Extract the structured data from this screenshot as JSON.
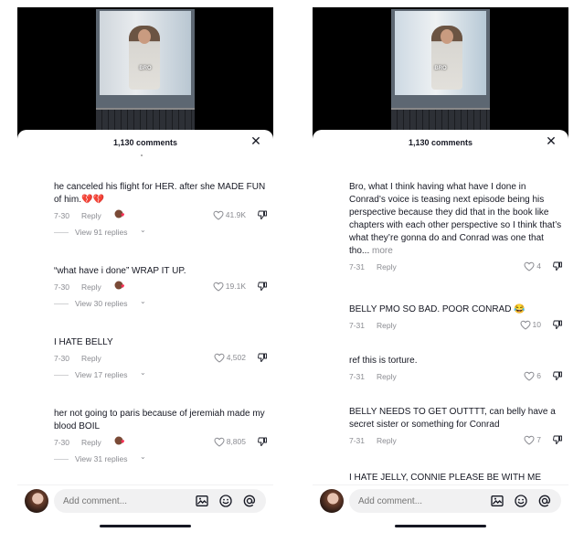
{
  "left": {
    "video_caption": "BRO",
    "header_title": "1,130 comments",
    "composer_placeholder": "Add comment...",
    "comments": [
      {
        "text": "he canceled his flight for HER. after she MADE FUN of him.💔💔",
        "date": "7-30",
        "reply": "Reply",
        "likes": "41.9K",
        "creator_liked": true,
        "view_replies": "View 91 replies"
      },
      {
        "text": "“what have i done” WRAP IT UP.",
        "date": "7-30",
        "reply": "Reply",
        "likes": "19.1K",
        "creator_liked": true,
        "view_replies": "View 30 replies"
      },
      {
        "text": "I HATE BELLY",
        "date": "7-30",
        "reply": "Reply",
        "likes": "4,502",
        "creator_liked": false,
        "view_replies": "View 17 replies"
      },
      {
        "text": "her not going to paris because of jeremiah made my blood BOIL",
        "date": "7-30",
        "reply": "Reply",
        "likes": "8,805",
        "creator_liked": true,
        "view_replies": "View 31 replies"
      }
    ]
  },
  "right": {
    "video_caption": "BRO",
    "header_title": "1,130 comments",
    "composer_placeholder": "Add comment...",
    "comments": [
      {
        "text": "Bro, what I think having what have I done in Conrad’s voice is teasing next episode being his perspective because they did that in the book like chapters with each other perspective so I think that’s what they’re gonna do and Conrad was one that tho...",
        "more": "more",
        "date": "7-31",
        "reply": "Reply",
        "likes": "4"
      },
      {
        "text": "BELLY PMO SO BAD. POOR CONRAD 😂",
        "date": "7-31",
        "reply": "Reply",
        "likes": "10"
      },
      {
        "text": "ref this is torture.",
        "date": "7-31",
        "reply": "Reply",
        "likes": "6"
      },
      {
        "text": "BELLY NEEDS TO GET OUTTTT, can belly have a secret sister or something for Conrad",
        "date": "7-31",
        "reply": "Reply",
        "likes": "7"
      },
      {
        "text": "I HATE JELLY, CONNIE PLEASE BE WITH ME"
      }
    ]
  },
  "icons": {
    "close": "close-icon",
    "heart": "heart-outline-icon",
    "dislike": "thumbs-down-icon",
    "image": "image-icon",
    "emoji": "emoji-icon",
    "mention": "at-mention-icon",
    "creator_liked": "creator-liked-badge-icon"
  },
  "colors": {
    "text": "#161823",
    "secondary": "#8a8b91",
    "heart_red": "#fe2c55",
    "input_bg": "#f1f1f2"
  }
}
